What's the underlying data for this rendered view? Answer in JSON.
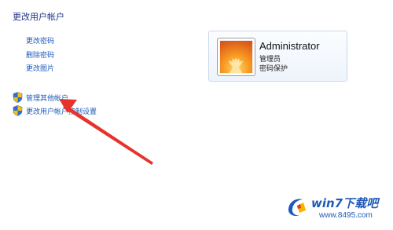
{
  "page": {
    "title": "更改用户帐户"
  },
  "tasks": [
    {
      "label": "更改密码"
    },
    {
      "label": "删除密码"
    },
    {
      "label": "更改图片"
    }
  ],
  "admin_tasks": [
    {
      "label": "管理其他帐户"
    },
    {
      "label": "更改用户帐户控制设置"
    }
  ],
  "account": {
    "name": "Administrator",
    "type": "管理员",
    "status": "密码保护"
  },
  "watermark": {
    "brand": "win7下载吧",
    "url": "www.8495.com"
  },
  "colors": {
    "link": "#1e5bb8",
    "title": "#1e3287",
    "arrow": "#e8322c",
    "card_border": "#c8d7ec"
  },
  "icons": {
    "shield": "uac-shield-icon",
    "avatar": "orange-flower-avatar-icon",
    "logo": "win7-logo-icon"
  }
}
